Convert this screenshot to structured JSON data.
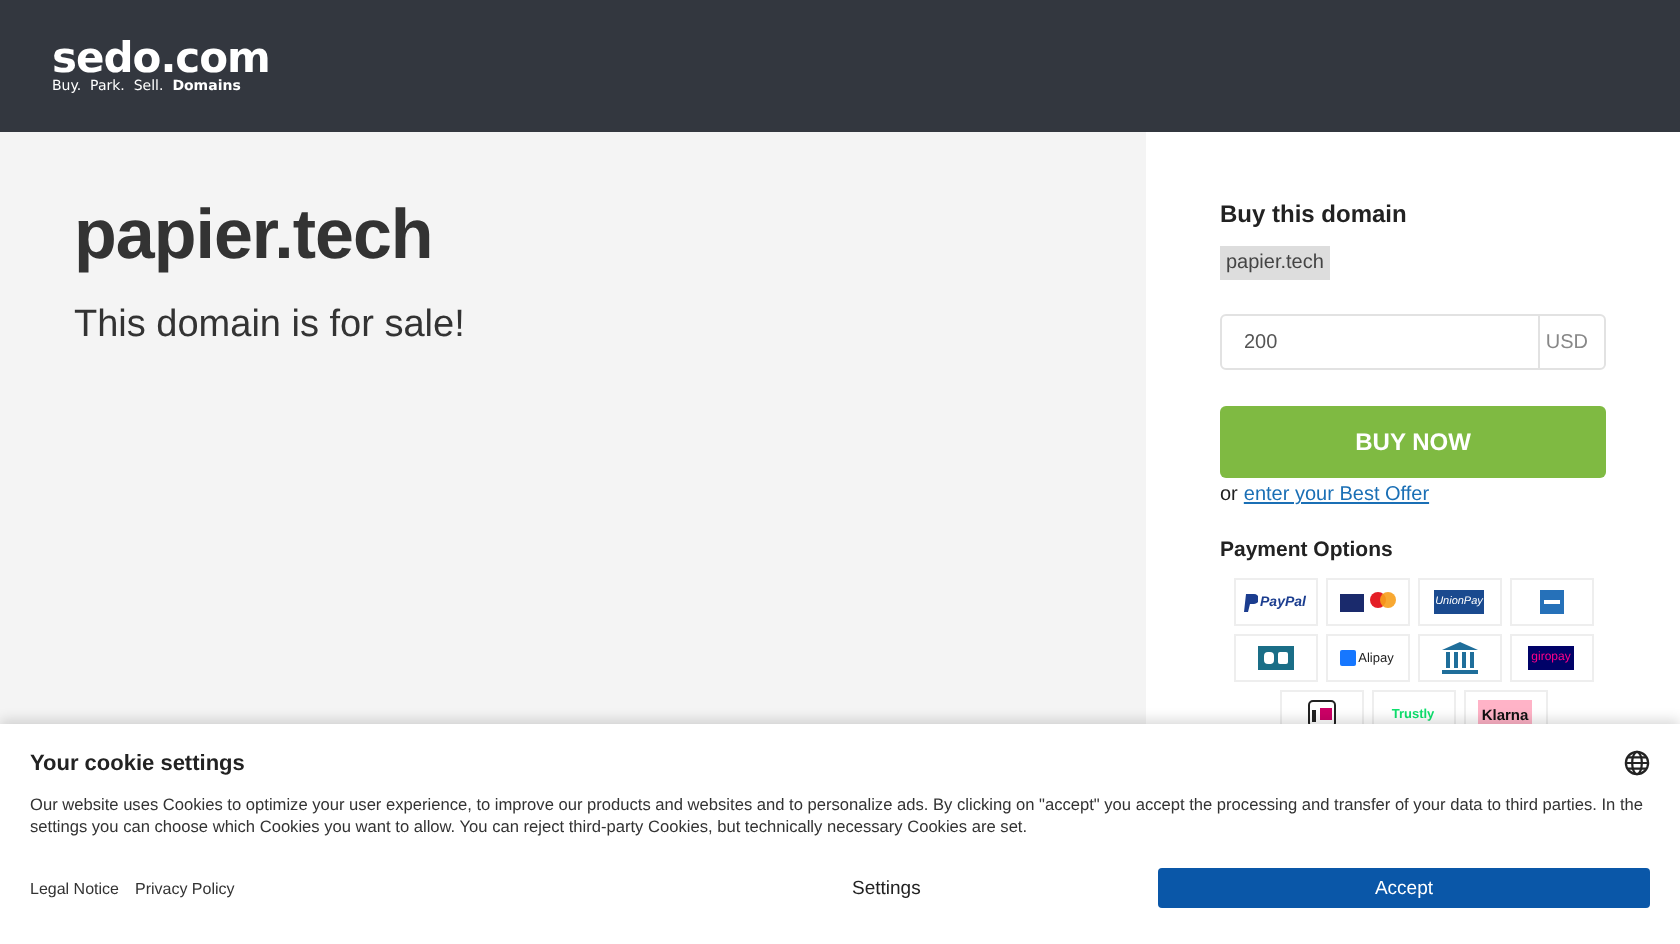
{
  "header": {
    "logo": "sedo.com",
    "tagline": "Buy.  Park.  Sell.  **Domains**"
  },
  "main": {
    "domain": "papier.tech",
    "subtitle": "This domain is for sale!"
  },
  "buy_panel": {
    "title": "Buy this domain",
    "domain_tag": "papier.tech",
    "price": {
      "value": "200",
      "currency": "USD"
    },
    "buy_button": "BUY NOW",
    "offer_prefix": "or",
    "offer_link": "enter your Best Offer",
    "payment_title": "Payment Options",
    "payment_methods": [
      {
        "kind": "paypal",
        "label": "PayPal"
      },
      {
        "kind": "cards"
      },
      {
        "kind": "unionpay",
        "label": "UnionPay"
      },
      {
        "kind": "amex"
      },
      {
        "kind": "cb"
      },
      {
        "kind": "alipay",
        "label": "Alipay"
      },
      {
        "kind": "bank"
      },
      {
        "kind": "giropay",
        "label": "giropay"
      },
      {
        "kind": "ideal"
      },
      {
        "kind": "trustly",
        "label": "Trustly"
      },
      {
        "kind": "klarna",
        "label": "Klarna"
      }
    ]
  },
  "cookie_banner": {
    "title": "Your cookie settings",
    "text": "Our website uses Cookies to optimize your user experience, to improve our products and websites and to personalize ads. By clicking on \"accept\" you accept the processing and transfer of your data to third parties. In the settings you can choose which Cookies you want to allow. You can reject third-party Cookies, but technically necessary Cookies are set.",
    "links": [
      "Legal Notice",
      "Privacy Policy"
    ],
    "settings_button": "Settings",
    "accept_button": "Accept"
  }
}
